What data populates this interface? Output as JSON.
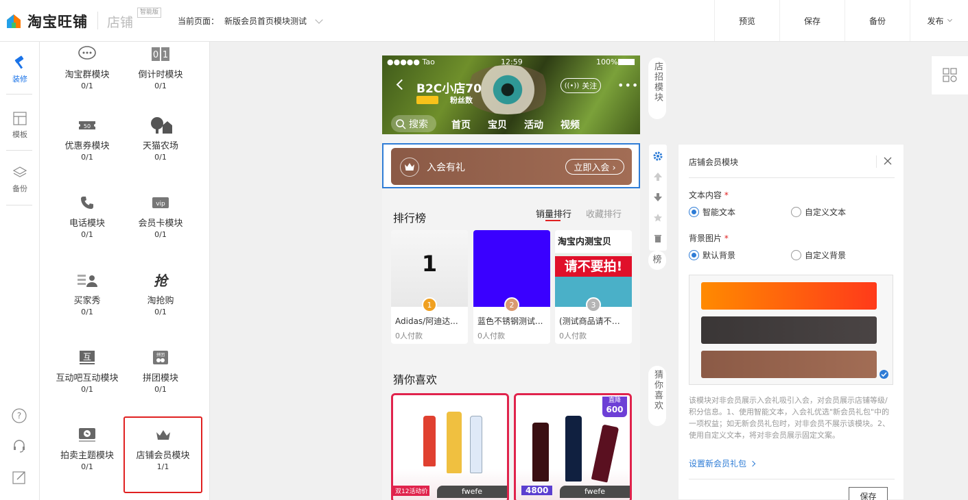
{
  "topbar": {
    "logo_text": "淘宝旺铺",
    "shop_label": "店铺",
    "edition_badge": "智能版",
    "current_page_label": "当前页面：",
    "current_page_value": "新版会员首页模块测试",
    "actions": [
      "预览",
      "保存",
      "备份",
      "发布"
    ]
  },
  "rail": {
    "items": [
      {
        "label": "装修",
        "icon": "hammer-icon"
      },
      {
        "label": "模板",
        "icon": "template-icon"
      },
      {
        "label": "备份",
        "icon": "layers-icon"
      }
    ],
    "bottom_icons": [
      "help-icon",
      "headset-icon",
      "edit-icon"
    ]
  },
  "modules": [
    {
      "name": "淘宝群模块",
      "count": "0/1",
      "icon": "chat-bubble-icon"
    },
    {
      "name": "倒计时模块",
      "count": "0/1",
      "icon": "countdown-icon"
    },
    {
      "name": "优惠券模块",
      "count": "0/1",
      "icon": "coupon-icon"
    },
    {
      "name": "天猫农场",
      "count": "0/1",
      "icon": "farm-icon"
    },
    {
      "name": "电话模块",
      "count": "0/1",
      "icon": "phone-icon"
    },
    {
      "name": "会员卡模块",
      "count": "0/1",
      "icon": "vip-card-icon"
    },
    {
      "name": "买家秀",
      "count": "0/1",
      "icon": "buyer-show-icon"
    },
    {
      "name": "淘抢购",
      "count": "0/1",
      "icon": "flash-sale-icon"
    },
    {
      "name": "互动吧互动模块",
      "count": "0/1",
      "icon": "interaction-icon"
    },
    {
      "name": "拼团模块",
      "count": "0/1",
      "icon": "group-buy-icon"
    },
    {
      "name": "拍卖主题模块",
      "count": "0/1",
      "icon": "auction-icon"
    },
    {
      "name": "店铺会员模块",
      "count": "1/1",
      "icon": "crown-icon"
    }
  ],
  "phone": {
    "status": {
      "carrier": "●●●●● Tao",
      "time": "12:59",
      "battery": "100%"
    },
    "shop_name": "B2C小店70",
    "fans_label": "粉丝数",
    "follow_label": "关注",
    "more_label": "•••",
    "search_label": "搜索",
    "nav_tabs": [
      "首页",
      "宝贝",
      "活动",
      "视频"
    ],
    "member": {
      "title": "入会有礼",
      "button": "立即入会 ›"
    },
    "ranking": {
      "title": "排行榜",
      "tabs": [
        "销量排行",
        "收藏排行"
      ],
      "items": [
        {
          "rank": "1",
          "name": "Adidas/阿迪达...",
          "paid": "0人付款",
          "image_text": "1"
        },
        {
          "rank": "2",
          "name": "蓝色不锈钢测试...",
          "paid": "0人付款"
        },
        {
          "rank": "3",
          "name": "(测试商品请不要...",
          "paid": "0人付款",
          "image_text_top": "淘宝内测宝贝",
          "image_text_main": "请不要拍!"
        }
      ]
    },
    "guess": {
      "title": "猜你喜欢",
      "items": [
        {
          "tag": "fwefe",
          "corner": "双12活动价"
        },
        {
          "tag": "fwefe",
          "corner": "4800",
          "badge_top": "直降",
          "badge_value": "600"
        }
      ]
    }
  },
  "side_labels": {
    "shop_sign": "店招模块",
    "ranking_partial": "榜",
    "guess": "猜你喜欢"
  },
  "settings": {
    "title": "店铺会员模块",
    "text_content_label": "文本内容",
    "text_options": [
      "智能文本",
      "自定义文本"
    ],
    "text_selected": 0,
    "bg_label": "背景图片",
    "bg_options": [
      "默认背景",
      "自定义背景"
    ],
    "bg_selected": 0,
    "bg_swatches": [
      "#ff6a00",
      "#3f3b3b",
      "#9b6a55"
    ],
    "description": "该模块对非会员展示入会礼吸引入会，对会员展示店铺等级/积分信息。1、使用智能文本，入会礼优选\"新会员礼包\"中的一项权益；如无新会员礼包时，对非会员不展示该模块。2、使用自定义文本，将对非会员展示固定文案。",
    "link_label": "设置新会员礼包",
    "save_label": "保存"
  },
  "colors": {
    "accent": "#2e7cd6",
    "selected_border": "#e02020",
    "member_card": "#9b6a55"
  }
}
